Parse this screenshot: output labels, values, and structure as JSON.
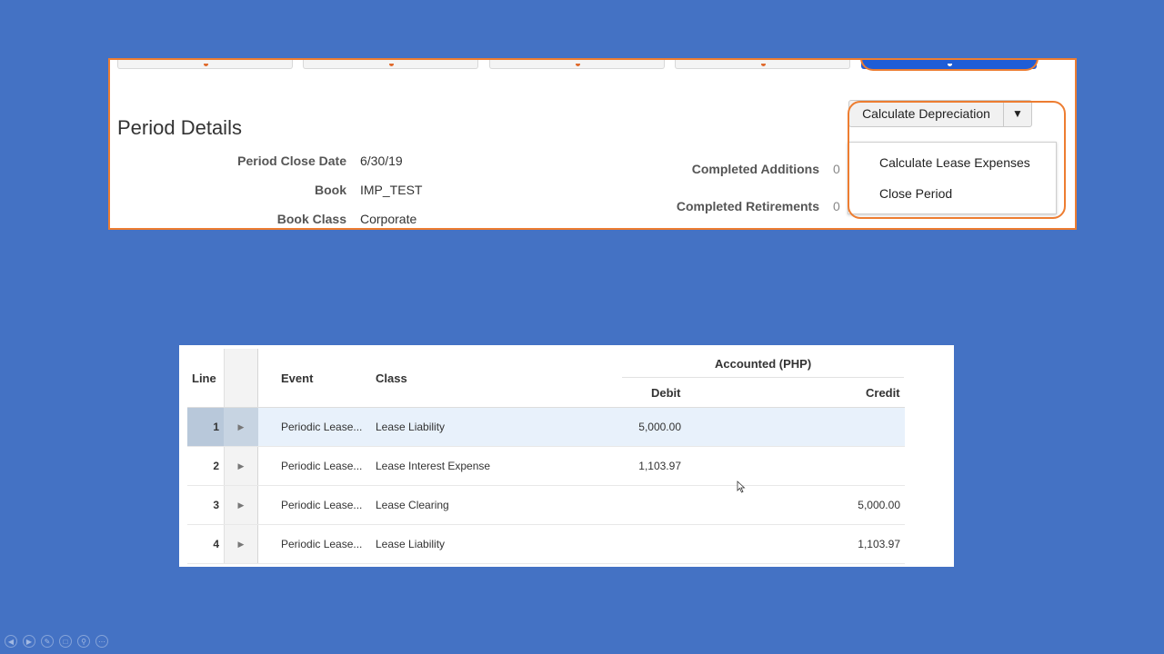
{
  "period_details": {
    "title": "Period Details",
    "fields": {
      "period_close_date": {
        "label": "Period Close Date",
        "value": "6/30/19"
      },
      "book": {
        "label": "Book",
        "value": "IMP_TEST"
      },
      "book_class": {
        "label": "Book Class",
        "value": "Corporate"
      },
      "completed_additions": {
        "label": "Completed Additions",
        "value": "0"
      },
      "completed_retirements": {
        "label": "Completed Retirements",
        "value": "0"
      }
    },
    "action_button": {
      "label": "Calculate Depreciation",
      "arrow": "▼"
    },
    "menu_items": [
      "Calculate Lease Expenses",
      "Close Period"
    ]
  },
  "journal_table": {
    "headers": {
      "line": "Line",
      "event": "Event",
      "class": "Class",
      "accounted": "Accounted (PHP)",
      "debit": "Debit",
      "credit": "Credit"
    },
    "rows": [
      {
        "line": "1",
        "event": "Periodic Lease...",
        "class": "Lease Liability",
        "debit": "5,000.00",
        "credit": ""
      },
      {
        "line": "2",
        "event": "Periodic Lease...",
        "class": "Lease Interest Expense",
        "debit": "1,103.97",
        "credit": ""
      },
      {
        "line": "3",
        "event": "Periodic Lease...",
        "class": "Lease Clearing",
        "debit": "",
        "credit": "5,000.00"
      },
      {
        "line": "4",
        "event": "Periodic Lease...",
        "class": "Lease Liability",
        "debit": "",
        "credit": "1,103.97"
      }
    ]
  },
  "colors": {
    "background": "#4472c4",
    "highlight": "#ed7d31",
    "selected_row": "#e8f1fb"
  },
  "icons": {
    "expand": "triangle-right-icon",
    "dropdown": "caret-down-icon",
    "cursor": "mouse-pointer-icon"
  }
}
